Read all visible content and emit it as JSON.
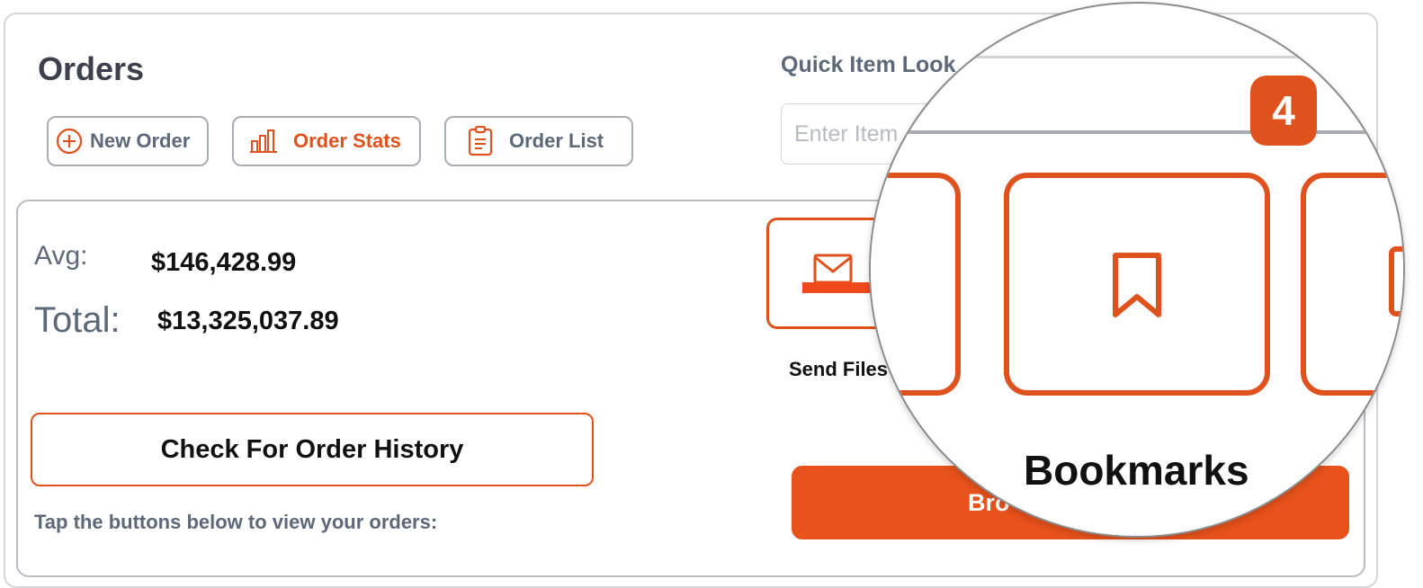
{
  "header": {
    "title": "Orders",
    "tabs": [
      {
        "label": "New Order",
        "icon": "plus-circle-icon"
      },
      {
        "label": "Order Stats",
        "icon": "bar-chart-icon"
      },
      {
        "label": "Order List",
        "icon": "clipboard-icon"
      }
    ]
  },
  "lookup": {
    "label": "Quick Item Look",
    "placeholder": "Enter Item"
  },
  "stats": {
    "avg_label": "Avg:",
    "avg_value": "$146,428.99",
    "total_label": "Total:",
    "total_value": "$13,325,037.89"
  },
  "history_button": "Check For Order History",
  "hint": "Tap the buttons below to view your orders:",
  "actions": {
    "send_files": {
      "label": "Send Files",
      "icon": "mail-icon"
    },
    "browse": {
      "label": "Bro"
    }
  },
  "callout": {
    "step_number": "4",
    "highlighted_label": "Bookmarks",
    "highlighted_icon": "bookmark-icon",
    "pointer_icon": "arrow-right-icon"
  },
  "colors": {
    "accent": "#e0521d",
    "button_fill": "#e8521b",
    "text_muted": "#5d6878",
    "heading": "#3c414b"
  }
}
